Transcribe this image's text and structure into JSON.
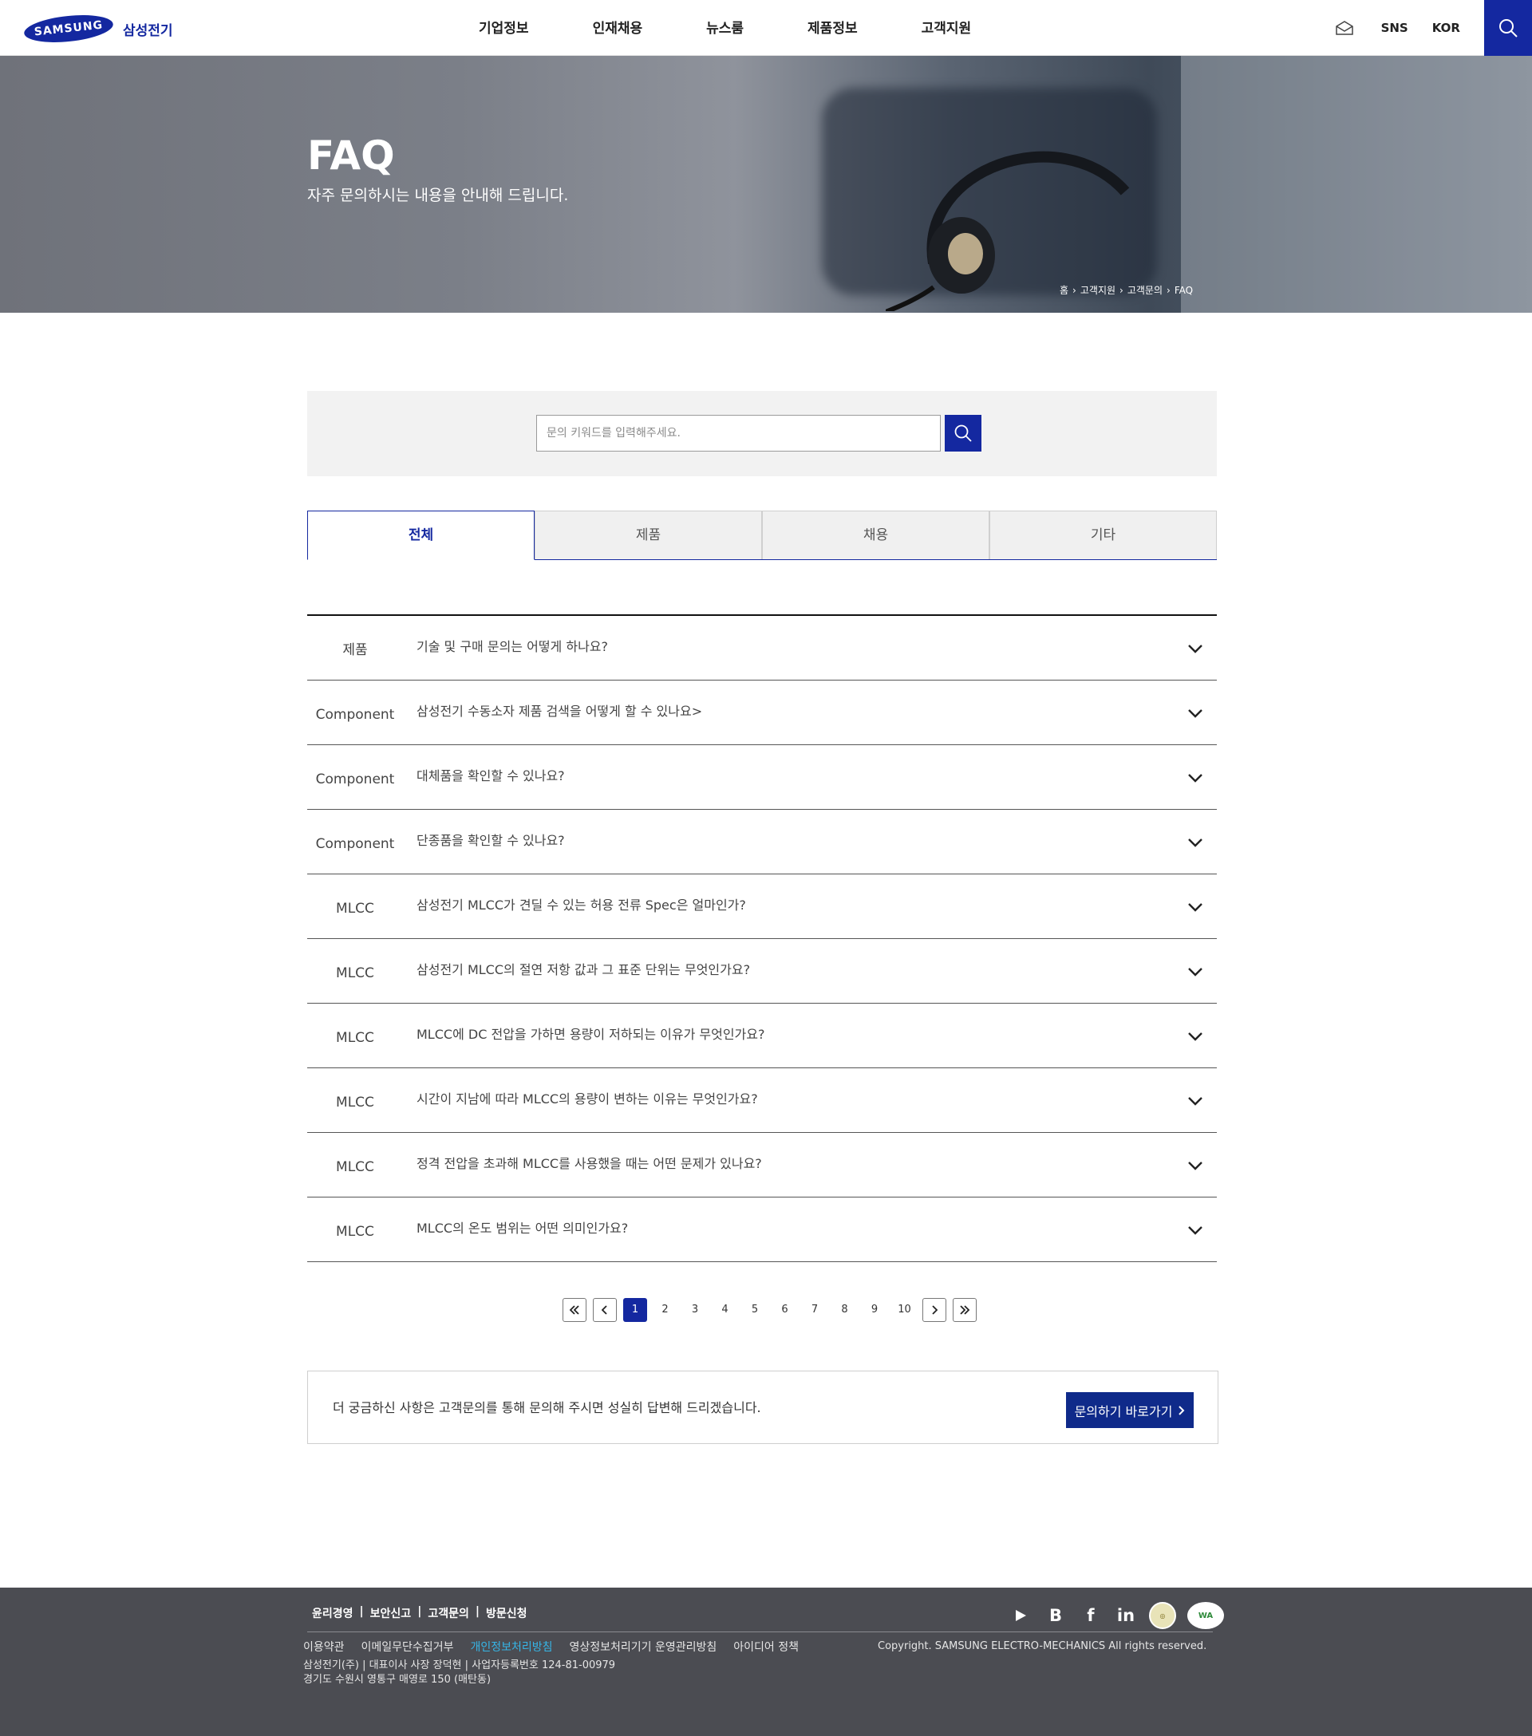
{
  "header": {
    "logo_text": "SAMSUNG",
    "logo_kor": "삼성전기",
    "nav": [
      "기업정보",
      "인재채용",
      "뉴스룸",
      "제품정보",
      "고객지원"
    ],
    "util_sns": "SNS",
    "util_lang": "KOR",
    "brand_color": "#1428a0"
  },
  "hero": {
    "title": "FAQ",
    "subtitle": "자주 문의하시는 내용을 안내해 드립니다.",
    "breadcrumb": [
      "홈",
      "고객지원",
      "고객문의",
      "FAQ"
    ]
  },
  "search": {
    "placeholder": "문의 키워드를 입력해주세요."
  },
  "tabs": [
    "전체",
    "제품",
    "채용",
    "기타"
  ],
  "faq": [
    {
      "category": "제품",
      "question": "기술 및 구매 문의는 어떻게 하나요?"
    },
    {
      "category": "Component",
      "question": "삼성전기 수동소자 제품 검색을 어떻게 할 수 있나요>"
    },
    {
      "category": "Component",
      "question": "대체품을 확인할 수 있나요?"
    },
    {
      "category": "Component",
      "question": "단종품을 확인할 수 있나요?"
    },
    {
      "category": "MLCC",
      "question": "삼성전기 MLCC가 견딜 수 있는 허용 전류 Spec은 얼마인가?"
    },
    {
      "category": "MLCC",
      "question": "삼성전기 MLCC의 절연 저항 값과 그 표준 단위는 무엇인가요?"
    },
    {
      "category": "MLCC",
      "question": "MLCC에 DC 전압을 가하면 용량이 저하되는 이유가 무엇인가요?"
    },
    {
      "category": "MLCC",
      "question": "시간이 지남에 따라 MLCC의 용량이 변하는 이유는 무엇인가요?"
    },
    {
      "category": "MLCC",
      "question": "정격 전압을 초과해 MLCC를 사용했을 때는 어떤 문제가 있나요?"
    },
    {
      "category": "MLCC",
      "question": "MLCC의 온도 범위는 어떤 의미인가요?"
    }
  ],
  "pagination": {
    "pages": [
      "1",
      "2",
      "3",
      "4",
      "5",
      "6",
      "7",
      "8",
      "9",
      "10"
    ],
    "current": "1"
  },
  "inquiry": {
    "text": "더 궁금하신 사항은 고객문의를 통해 문의해 주시면 성실히 답변해 드리겠습니다.",
    "button": "문의하기 바로가기"
  },
  "footer": {
    "links": [
      "윤리경영",
      "보안신고",
      "고객문의",
      "방문신청"
    ],
    "social": [
      "play-icon",
      "blog-icon",
      "facebook-icon",
      "linkedin-icon"
    ],
    "social_text": {
      "blog": "B",
      "facebook": "f",
      "linkedin": "in"
    },
    "policies": [
      "이용약관",
      "이메일무단수집거부",
      "개인정보처리방침",
      "영상정보처리기기 운영관리방침",
      "아이디어 정책"
    ],
    "highlight_policy": "개인정보처리방침",
    "copyright": "Copyright. SAMSUNG ELECTRO-MECHANICS All rights reserved.",
    "address1": "삼성전기(주) | 대표이사 사장 장덕현 | 사업자등록번호 124-81-00979",
    "address2": "경기도 수원시 영통구 매영로 150 (매탄동)"
  }
}
